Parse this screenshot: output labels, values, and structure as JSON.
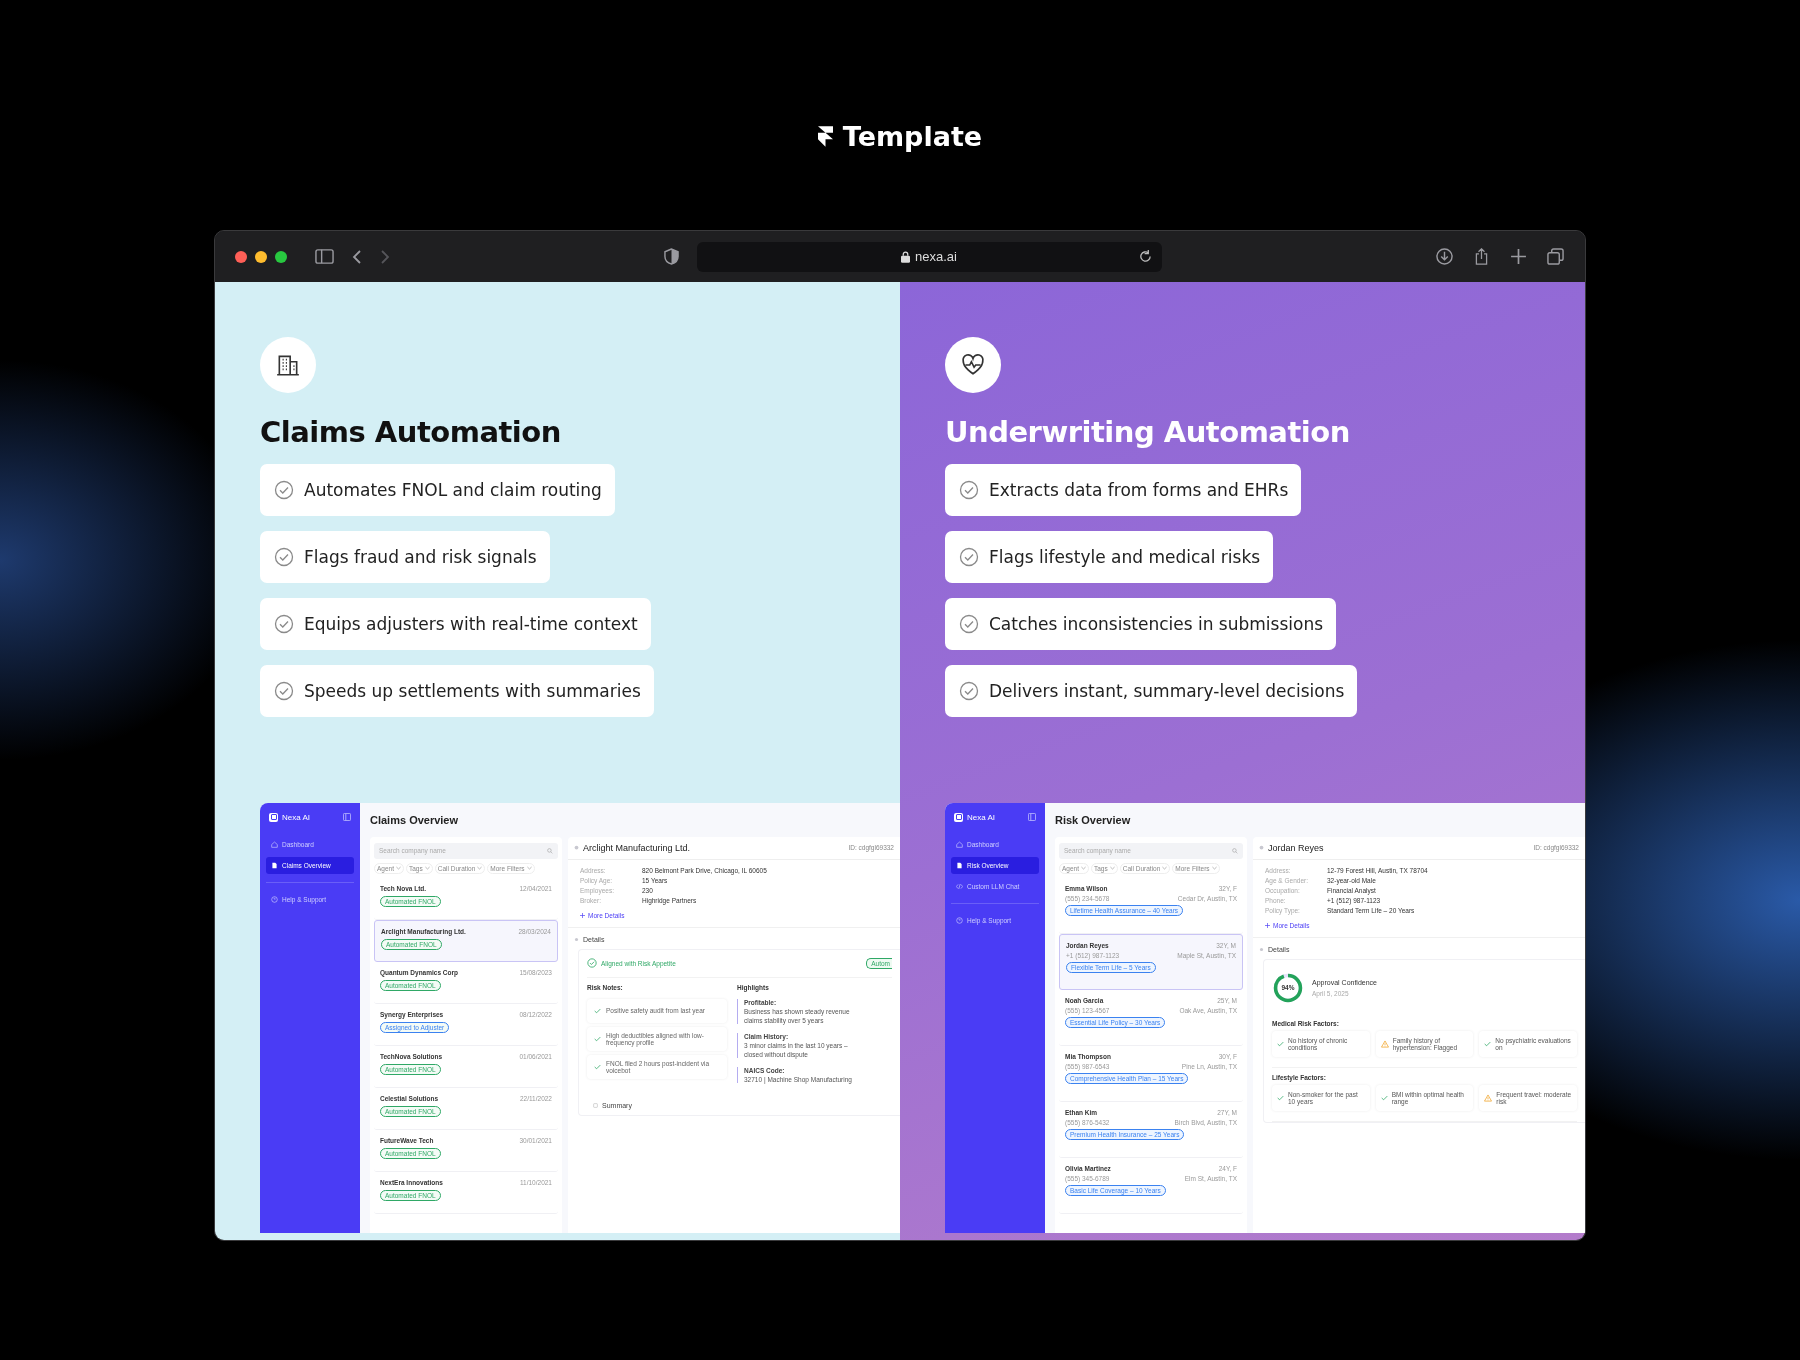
{
  "header": {
    "title": "Template"
  },
  "browser": {
    "url": "nexa.ai"
  },
  "panels": [
    {
      "kind": "claims",
      "title": "Claims Automation",
      "features": [
        "Automates FNOL and claim routing",
        "Flags fraud and risk signals",
        "Equips adjusters with real-time context",
        "Speeds up settlements with summaries"
      ],
      "app": {
        "brand": "Nexa AI",
        "nav": [
          {
            "kind": "dashboard",
            "label": "Dashboard",
            "selected": false
          },
          {
            "kind": "document",
            "label": "Claims Overview",
            "selected": true
          },
          {
            "kind": "help",
            "label": "Help & Support",
            "selected": false
          }
        ],
        "heading": "Claims Overview",
        "search": {
          "placeholder": "Search company name"
        },
        "filters": [
          "Agent",
          "Tags",
          "Call Duration",
          "More Filters"
        ],
        "list": [
          {
            "name": "Tech Nova Ltd.",
            "date": "12/04/2021",
            "tag": "Automated FNOL",
            "color": "#2fa866",
            "selected": false
          },
          {
            "name": "Arclight Manufacturing Ltd.",
            "date": "28/03/2024",
            "tag": "Automated FNOL",
            "color": "#2fa866",
            "selected": true
          },
          {
            "name": "Quantum Dynamics Corp",
            "date": "15/08/2023",
            "tag": "Automated FNOL",
            "color": "#2fa866",
            "selected": false
          },
          {
            "name": "Synergy Enterprises",
            "date": "08/12/2022",
            "tag": "Assigned to Adjuster",
            "color": "#3b82f0",
            "selected": false
          },
          {
            "name": "TechNova Solutions",
            "date": "01/06/2021",
            "tag": "Automated FNOL",
            "color": "#2fa866",
            "selected": false
          },
          {
            "name": "Celestial Solutions",
            "date": "22/11/2022",
            "tag": "Automated FNOL",
            "color": "#2fa866",
            "selected": false
          },
          {
            "name": "FutureWave Tech",
            "date": "30/01/2021",
            "tag": "Automated FNOL",
            "color": "#2fa866",
            "selected": false
          },
          {
            "name": "NextEra Innovations",
            "date": "11/10/2021",
            "tag": "Automated FNOL",
            "color": "#2fa866",
            "selected": false
          }
        ],
        "detail": {
          "title": "Arclight Manufacturing Ltd.",
          "id": "ID: cdgfgl69332",
          "fields": [
            {
              "label": "Address:",
              "value": "820 Belmont Park Drive, Chicago, IL 60605"
            },
            {
              "label": "Policy Age:",
              "value": "15 Years"
            },
            {
              "label": "Employees:",
              "value": "230"
            },
            {
              "label": "Broker:",
              "value": "Highridge Partners"
            }
          ],
          "more": "More Details",
          "section": "Details",
          "status": "Aligned with Risk Appetite",
          "badge": "Autom",
          "notes_title": "Risk Notes:",
          "notes": [
            "Positive safety audit from last year",
            "High deductibles aligned with low-frequency profile",
            "FNOL filed 2 hours post-incident via voicebot"
          ],
          "highlights_title": "Highlights",
          "highlights": [
            {
              "label": "Profitable:",
              "lines": [
                "Business has shown steady revenue",
                "claims stability over 5 years"
              ]
            },
            {
              "label": "Claim History:",
              "lines": [
                "3 minor claims in the last 10 years –",
                "closed without dispute"
              ]
            },
            {
              "label": "NAICS Code:",
              "lines": [
                "32710 | Machine Shop Manufacturing"
              ]
            }
          ],
          "summary": "Summary"
        }
      }
    },
    {
      "kind": "underwriting",
      "title": "Underwriting Automation",
      "features": [
        "Extracts data from forms and EHRs",
        "Flags lifestyle and medical risks",
        "Catches inconsistencies in submissions",
        "Delivers instant, summary-level decisions"
      ],
      "app": {
        "brand": "Nexa AI",
        "nav": [
          {
            "kind": "dashboard",
            "label": "Dashboard",
            "selected": false
          },
          {
            "kind": "document",
            "label": "Risk Overview",
            "selected": true
          },
          {
            "kind": "code",
            "label": "Custom LLM Chat",
            "selected": false
          },
          {
            "kind": "help",
            "label": "Help & Support",
            "selected": false
          }
        ],
        "heading": "Risk Overview",
        "search": {
          "placeholder": "Search company name"
        },
        "filters": [
          "Agent",
          "Tags",
          "Call Duration",
          "More Filters"
        ],
        "list": [
          {
            "name": "Emma Wilson",
            "age": "32Y, F",
            "phone": "(555) 234-5678",
            "location": "Cedar Dr, Austin, TX",
            "tag": "Lifetime Health Assurance – 40 Years",
            "selected": false
          },
          {
            "name": "Jordan Reyes",
            "age": "32Y, M",
            "phone": "+1 (512) 987-1123",
            "location": "Maple St, Austin, TX",
            "tag": "Flexible Term Life – 5 Years",
            "selected": true
          },
          {
            "name": "Noah Garcia",
            "age": "25Y, M",
            "phone": "(555) 123-4567",
            "location": "Oak Ave, Austin, TX",
            "tag": "Essential Life Policy – 30 Years",
            "selected": false
          },
          {
            "name": "Mia Thompson",
            "age": "30Y, F",
            "phone": "(555) 987-6543",
            "location": "Pine Ln, Austin, TX",
            "tag": "Comprehensive Health Plan – 15 Years",
            "selected": false
          },
          {
            "name": "Ethan Kim",
            "age": "27Y, M",
            "phone": "(555) 876-5432",
            "location": "Birch Blvd, Austin, TX",
            "tag": "Premium Health Insurance – 25 Years",
            "selected": false
          },
          {
            "name": "Olivia Martinez",
            "age": "24Y, F",
            "phone": "(555) 345-6789",
            "location": "Elm St, Austin, TX",
            "tag": "Basic Life Coverage – 10 Years",
            "selected": false
          }
        ],
        "detail": {
          "title": "Jordan Reyes",
          "id": "ID: cdgfgl69332",
          "fields": [
            {
              "label": "Address:",
              "value": "12-79 Forest Hill, Austin, TX 78704"
            },
            {
              "label": "Age & Gender:",
              "value": "32-year-old Male"
            },
            {
              "label": "Occupation:",
              "value": "Financial Analyst"
            },
            {
              "label": "Phone:",
              "value": "+1 (512) 987-1123"
            },
            {
              "label": "Policy Type:",
              "value": "Standard Term Life – 20 Years"
            }
          ],
          "more": "More Details",
          "section": "Details",
          "confidence": {
            "value": "94%",
            "level": 0.94,
            "label": "Approval Confidence",
            "date": "April 5, 2025"
          },
          "groups": [
            {
              "title": "Medical Risk Factors:",
              "items": [
                {
                  "kind": "ok",
                  "text": "No history of chronic conditions"
                },
                {
                  "kind": "warn",
                  "text": "Family history of hypertension: Flagged"
                },
                {
                  "kind": "ok",
                  "text": "No psychiatric evaluations on"
                }
              ]
            },
            {
              "title": "Lifestyle Factors:",
              "items": [
                {
                  "kind": "ok",
                  "text": "Non-smoker for the past 10 years"
                },
                {
                  "kind": "ok",
                  "text": "BMI within optimal health range"
                },
                {
                  "kind": "warn",
                  "text": "Frequent travel: moderate risk"
                }
              ]
            }
          ]
        }
      }
    }
  ]
}
